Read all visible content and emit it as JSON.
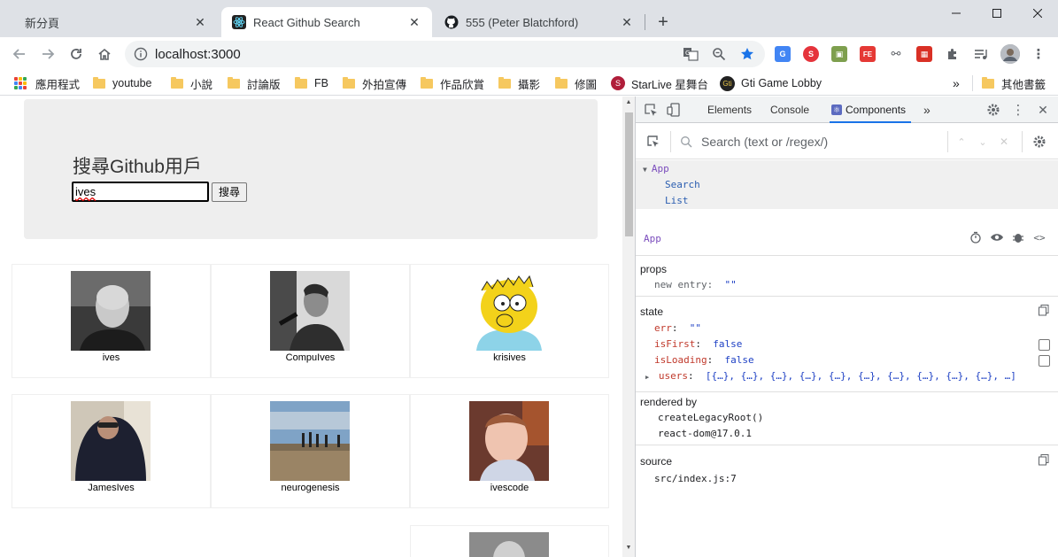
{
  "browser": {
    "tabs": [
      {
        "title": "新分頁"
      },
      {
        "title": "React Github Search"
      },
      {
        "title": "555 (Peter Blatchford)"
      }
    ],
    "url": "localhost:3000"
  },
  "bookmarks": [
    {
      "label": "應用程式",
      "icon": "apps-grid-icon"
    },
    {
      "label": "youtube",
      "icon": "folder-icon"
    },
    {
      "label": "小說",
      "icon": "folder-icon"
    },
    {
      "label": "討論版",
      "icon": "folder-icon"
    },
    {
      "label": "FB",
      "icon": "folder-icon"
    },
    {
      "label": "外拍宣傳",
      "icon": "folder-icon"
    },
    {
      "label": "作品欣賞",
      "icon": "folder-icon"
    },
    {
      "label": "攝影",
      "icon": "folder-icon"
    },
    {
      "label": "修圖",
      "icon": "folder-icon"
    },
    {
      "label": "StarLive 星舞台",
      "icon": "starlive-icon"
    },
    {
      "label": "Gti Game Lobby",
      "icon": "gti-icon"
    },
    {
      "label": "其他書籤",
      "icon": "folder-icon"
    }
  ],
  "app": {
    "title": "搜尋Github用戶",
    "search_value": "ives",
    "search_button": "搜尋",
    "users": [
      {
        "login": "ives"
      },
      {
        "login": "CompuIves"
      },
      {
        "login": "krisives"
      },
      {
        "login": "JamesIves"
      },
      {
        "login": "neurogenesis"
      },
      {
        "login": "ivescode"
      }
    ]
  },
  "devtools": {
    "tabs": [
      "Elements",
      "Console",
      "Components"
    ],
    "search_placeholder": "Search (text or /regex/)",
    "tree": {
      "root": "App",
      "children": [
        "Search",
        "List"
      ]
    },
    "selected": "App",
    "props": {
      "header": "props",
      "entries": [
        {
          "key": "new entry",
          "value": "\"\""
        }
      ]
    },
    "state": {
      "header": "state",
      "err_key": "err",
      "err_val": "\"\"",
      "isFirst_key": "isFirst",
      "isFirst_val": "false",
      "isLoading_key": "isLoading",
      "isLoading_val": "false",
      "users_key": "users",
      "users_val": "[{…}, {…}, {…}, {…}, {…}, {…}, {…}, {…}, {…}, {…}, …]"
    },
    "rendered_by": {
      "header": "rendered by",
      "items": [
        "createLegacyRoot()",
        "react-dom@17.0.1"
      ]
    },
    "source": {
      "header": "source",
      "value": "src/index.js:7"
    }
  }
}
